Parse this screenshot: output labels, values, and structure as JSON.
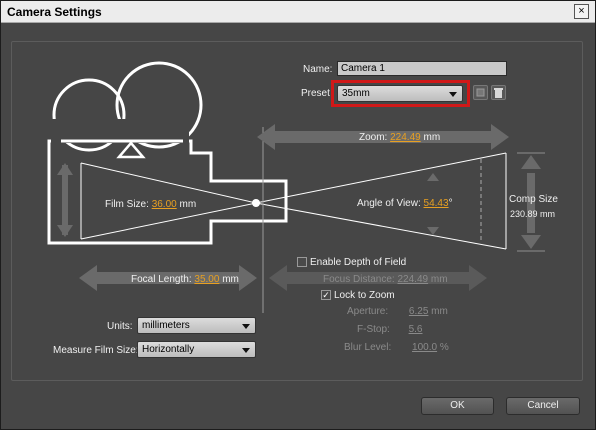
{
  "window": {
    "title": "Camera Settings",
    "close_glyph": "×"
  },
  "name": {
    "label": "Name:",
    "value": "Camera 1"
  },
  "preset": {
    "label": "Preset",
    "value": "35mm"
  },
  "zoom": {
    "label": "Zoom:",
    "value": "224.49",
    "unit": "mm"
  },
  "angle": {
    "label": "Angle of View:",
    "value": "54.43",
    "unit": "°"
  },
  "film_size": {
    "label": "Film Size:",
    "value": "36.00",
    "unit": "mm"
  },
  "comp_size": {
    "label": "Comp Size",
    "value": "230.89 mm"
  },
  "focal_length": {
    "label": "Focal Length:",
    "value": "35.00",
    "unit": "mm"
  },
  "depth_of_field": {
    "label": "Enable Depth of Field",
    "checked": false
  },
  "focus_distance": {
    "label": "Focus Distance:",
    "value": "224.49",
    "unit": "mm"
  },
  "lock_to_zoom": {
    "label": "Lock to Zoom",
    "checked": true,
    "glyph": "✓"
  },
  "aperture": {
    "label": "Aperture:",
    "value": "6.25",
    "unit": "mm"
  },
  "fstop": {
    "label": "F-Stop:",
    "value": "5.6"
  },
  "blur": {
    "label": "Blur Level:",
    "value": "100.0",
    "unit": "%"
  },
  "units": {
    "label": "Units:",
    "value": "millimeters"
  },
  "measure": {
    "label": "Measure Film Size:",
    "value": "Horizontally"
  },
  "buttons": {
    "ok": "OK",
    "cancel": "Cancel"
  },
  "colors": {
    "dialog_bg": "#464646",
    "accent_value": "#e8a021",
    "highlight": "#d01818",
    "diagram_line": "#ffffff",
    "arrow": "#6a6a6a"
  }
}
